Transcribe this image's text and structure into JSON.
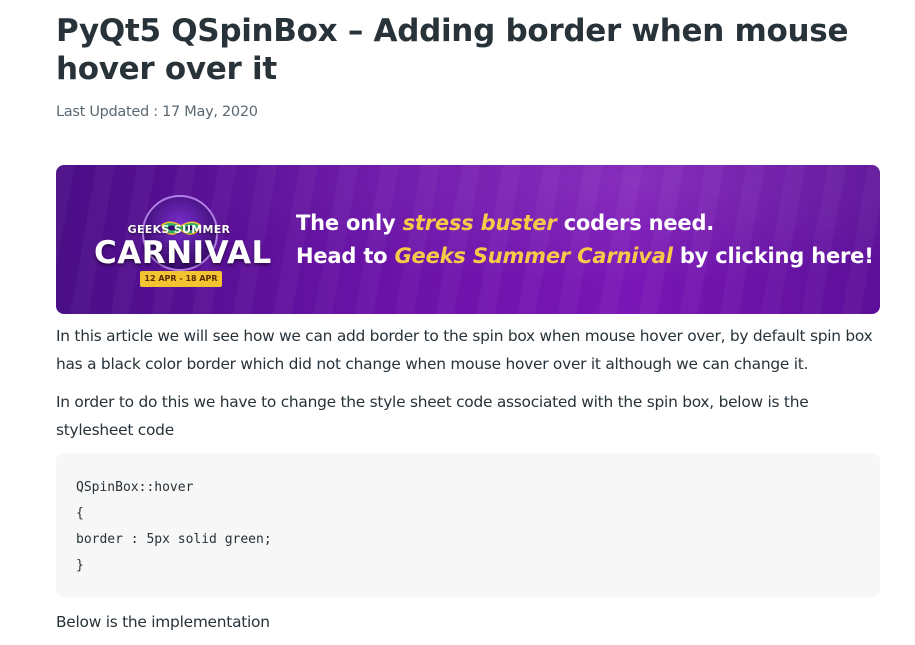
{
  "article": {
    "title": "PyQt5 QSpinBox – Adding border when mouse hover over it",
    "last_updated": "Last Updated : 17 May, 2020",
    "banner": {
      "logo_top": "GEEKS SUMMER",
      "logo_main": "CARNIVAL",
      "logo_dates": "12 APR - 18 APR",
      "line1_pre": "The only ",
      "line1_hl": "stress buster",
      "line1_post": " coders need.",
      "line2_pre": "Head to ",
      "line2_hl": "Geeks Summer Carnival",
      "line2_post": " by clicking here!"
    },
    "paragraph1": "In this article we will see how we can add border to the spin box when mouse hover over, by default spin box has a black color border which did not change when mouse hover over it although we can change it.",
    "paragraph2": "In order to do this we have to change the style sheet code associated with the spin box, below is the stylesheet code",
    "code_lines": [
      "QSpinBox::hover",
      "{",
      "border : 5px solid green;",
      "}"
    ],
    "paragraph3": "Below is the implementation"
  },
  "colors": {
    "text": "#273239",
    "muted": "#5b6870",
    "banner_bg": "#6a12a8",
    "highlight": "#f7c948",
    "code_bg": "#f7f7f7"
  }
}
